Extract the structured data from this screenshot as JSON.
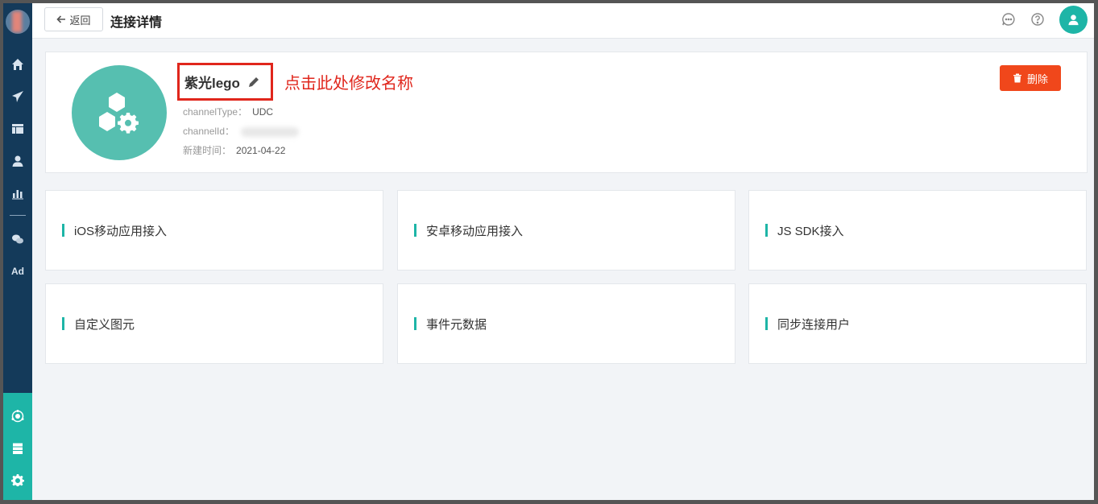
{
  "topbar": {
    "back_label": "返回",
    "title": "连接详情"
  },
  "channel": {
    "name": "紫光lego",
    "annotation": "点击此处修改名称",
    "channel_type_label": "channelType：",
    "channel_type_value": "UDC",
    "channel_id_label": "channelId：",
    "created_label": "新建时间：",
    "created_value": "2021-04-22",
    "delete_label": "删除"
  },
  "cards": [
    {
      "label": "iOS移动应用接入"
    },
    {
      "label": "安卓移动应用接入"
    },
    {
      "label": "JS SDK接入"
    },
    {
      "label": "自定义图元"
    },
    {
      "label": "事件元数据"
    },
    {
      "label": "同步连接用户"
    }
  ],
  "sidebar": {
    "items": [
      {
        "icon": "home-icon"
      },
      {
        "icon": "send-icon"
      },
      {
        "icon": "layout-icon"
      },
      {
        "icon": "user-icon"
      },
      {
        "icon": "bar-chart-icon"
      },
      {
        "icon": "wechat-icon"
      },
      {
        "icon": "ad-icon",
        "text": "Ad"
      }
    ],
    "bottom_items": [
      {
        "icon": "connections-icon"
      },
      {
        "icon": "server-icon"
      },
      {
        "icon": "gear-icon"
      }
    ]
  },
  "colors": {
    "sidebar": "#143a5a",
    "accent": "#1eb5a7",
    "danger": "#f0471b",
    "annotation": "#e0261c"
  }
}
